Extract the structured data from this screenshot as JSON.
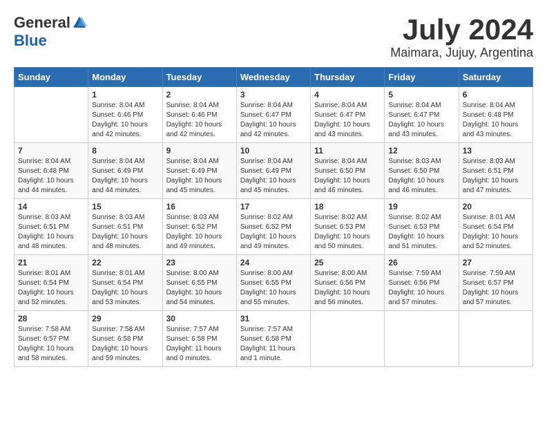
{
  "header": {
    "logo_general": "General",
    "logo_blue": "Blue",
    "month_year": "July 2024",
    "location": "Maimara, Jujuy, Argentina"
  },
  "days_of_week": [
    "Sunday",
    "Monday",
    "Tuesday",
    "Wednesday",
    "Thursday",
    "Friday",
    "Saturday"
  ],
  "weeks": [
    [
      {
        "day": "",
        "info": ""
      },
      {
        "day": "1",
        "info": "Sunrise: 8:04 AM\nSunset: 6:46 PM\nDaylight: 10 hours\nand 42 minutes."
      },
      {
        "day": "2",
        "info": "Sunrise: 8:04 AM\nSunset: 6:46 PM\nDaylight: 10 hours\nand 42 minutes."
      },
      {
        "day": "3",
        "info": "Sunrise: 8:04 AM\nSunset: 6:47 PM\nDaylight: 10 hours\nand 42 minutes."
      },
      {
        "day": "4",
        "info": "Sunrise: 8:04 AM\nSunset: 6:47 PM\nDaylight: 10 hours\nand 43 minutes."
      },
      {
        "day": "5",
        "info": "Sunrise: 8:04 AM\nSunset: 6:47 PM\nDaylight: 10 hours\nand 43 minutes."
      },
      {
        "day": "6",
        "info": "Sunrise: 8:04 AM\nSunset: 6:48 PM\nDaylight: 10 hours\nand 43 minutes."
      }
    ],
    [
      {
        "day": "7",
        "info": "Sunrise: 8:04 AM\nSunset: 6:48 PM\nDaylight: 10 hours\nand 44 minutes."
      },
      {
        "day": "8",
        "info": "Sunrise: 8:04 AM\nSunset: 6:49 PM\nDaylight: 10 hours\nand 44 minutes."
      },
      {
        "day": "9",
        "info": "Sunrise: 8:04 AM\nSunset: 6:49 PM\nDaylight: 10 hours\nand 45 minutes."
      },
      {
        "day": "10",
        "info": "Sunrise: 8:04 AM\nSunset: 6:49 PM\nDaylight: 10 hours\nand 45 minutes."
      },
      {
        "day": "11",
        "info": "Sunrise: 8:04 AM\nSunset: 6:50 PM\nDaylight: 10 hours\nand 46 minutes."
      },
      {
        "day": "12",
        "info": "Sunrise: 8:03 AM\nSunset: 6:50 PM\nDaylight: 10 hours\nand 46 minutes."
      },
      {
        "day": "13",
        "info": "Sunrise: 8:03 AM\nSunset: 6:51 PM\nDaylight: 10 hours\nand 47 minutes."
      }
    ],
    [
      {
        "day": "14",
        "info": "Sunrise: 8:03 AM\nSunset: 6:51 PM\nDaylight: 10 hours\nand 48 minutes."
      },
      {
        "day": "15",
        "info": "Sunrise: 8:03 AM\nSunset: 6:51 PM\nDaylight: 10 hours\nand 48 minutes."
      },
      {
        "day": "16",
        "info": "Sunrise: 8:03 AM\nSunset: 6:52 PM\nDaylight: 10 hours\nand 49 minutes."
      },
      {
        "day": "17",
        "info": "Sunrise: 8:02 AM\nSunset: 6:52 PM\nDaylight: 10 hours\nand 49 minutes."
      },
      {
        "day": "18",
        "info": "Sunrise: 8:02 AM\nSunset: 6:53 PM\nDaylight: 10 hours\nand 50 minutes."
      },
      {
        "day": "19",
        "info": "Sunrise: 8:02 AM\nSunset: 6:53 PM\nDaylight: 10 hours\nand 51 minutes."
      },
      {
        "day": "20",
        "info": "Sunrise: 8:01 AM\nSunset: 6:54 PM\nDaylight: 10 hours\nand 52 minutes."
      }
    ],
    [
      {
        "day": "21",
        "info": "Sunrise: 8:01 AM\nSunset: 6:54 PM\nDaylight: 10 hours\nand 52 minutes."
      },
      {
        "day": "22",
        "info": "Sunrise: 8:01 AM\nSunset: 6:54 PM\nDaylight: 10 hours\nand 53 minutes."
      },
      {
        "day": "23",
        "info": "Sunrise: 8:00 AM\nSunset: 6:55 PM\nDaylight: 10 hours\nand 54 minutes."
      },
      {
        "day": "24",
        "info": "Sunrise: 8:00 AM\nSunset: 6:55 PM\nDaylight: 10 hours\nand 55 minutes."
      },
      {
        "day": "25",
        "info": "Sunrise: 8:00 AM\nSunset: 6:56 PM\nDaylight: 10 hours\nand 56 minutes."
      },
      {
        "day": "26",
        "info": "Sunrise: 7:59 AM\nSunset: 6:56 PM\nDaylight: 10 hours\nand 57 minutes."
      },
      {
        "day": "27",
        "info": "Sunrise: 7:59 AM\nSunset: 6:57 PM\nDaylight: 10 hours\nand 57 minutes."
      }
    ],
    [
      {
        "day": "28",
        "info": "Sunrise: 7:58 AM\nSunset: 6:57 PM\nDaylight: 10 hours\nand 58 minutes."
      },
      {
        "day": "29",
        "info": "Sunrise: 7:58 AM\nSunset: 6:58 PM\nDaylight: 10 hours\nand 59 minutes."
      },
      {
        "day": "30",
        "info": "Sunrise: 7:57 AM\nSunset: 6:58 PM\nDaylight: 11 hours\nand 0 minutes."
      },
      {
        "day": "31",
        "info": "Sunrise: 7:57 AM\nSunset: 6:58 PM\nDaylight: 11 hours\nand 1 minute."
      },
      {
        "day": "",
        "info": ""
      },
      {
        "day": "",
        "info": ""
      },
      {
        "day": "",
        "info": ""
      }
    ]
  ]
}
